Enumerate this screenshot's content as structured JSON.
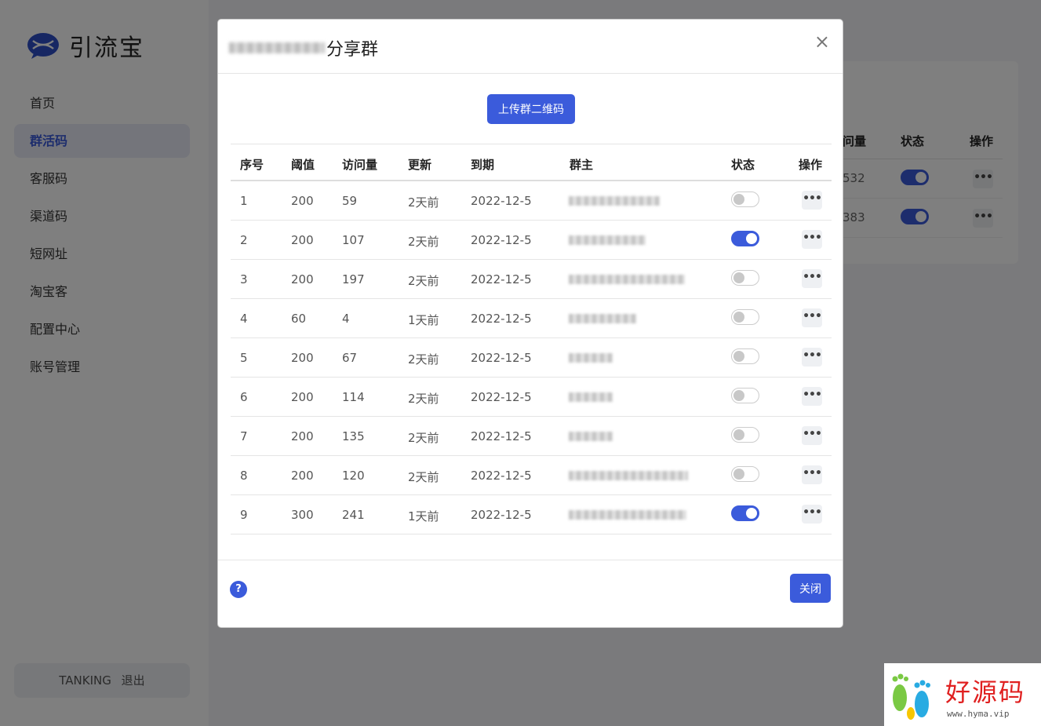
{
  "app": {
    "name": "引流宝"
  },
  "sidebar": {
    "items": [
      {
        "label": "首页",
        "active": false
      },
      {
        "label": "群活码",
        "active": true
      },
      {
        "label": "客服码",
        "active": false
      },
      {
        "label": "渠道码",
        "active": false
      },
      {
        "label": "短网址",
        "active": false
      },
      {
        "label": "淘宝客",
        "active": false
      },
      {
        "label": "配置中心",
        "active": false
      },
      {
        "label": "账号管理",
        "active": false
      }
    ],
    "user": {
      "name": "TANKING",
      "logout": "退出"
    }
  },
  "background_table": {
    "headers": [
      "问量",
      "状态",
      "操作"
    ],
    "rows": [
      {
        "visits": "532",
        "enabled": true
      },
      {
        "visits": "383",
        "enabled": true
      }
    ]
  },
  "modal": {
    "title_suffix": "分享群",
    "upload_button": "上传群二维码",
    "columns": [
      "序号",
      "阈值",
      "访问量",
      "更新",
      "到期",
      "群主",
      "状态",
      "操作"
    ],
    "rows": [
      {
        "index": "1",
        "threshold": "200",
        "visits": "59",
        "updated": "2天前",
        "expires": "2022-12-5",
        "enabled": false
      },
      {
        "index": "2",
        "threshold": "200",
        "visits": "107",
        "updated": "2天前",
        "expires": "2022-12-5",
        "enabled": true
      },
      {
        "index": "3",
        "threshold": "200",
        "visits": "197",
        "updated": "2天前",
        "expires": "2022-12-5",
        "enabled": false
      },
      {
        "index": "4",
        "threshold": "60",
        "visits": "4",
        "updated": "1天前",
        "expires": "2022-12-5",
        "enabled": false
      },
      {
        "index": "5",
        "threshold": "200",
        "visits": "67",
        "updated": "2天前",
        "expires": "2022-12-5",
        "enabled": false
      },
      {
        "index": "6",
        "threshold": "200",
        "visits": "114",
        "updated": "2天前",
        "expires": "2022-12-5",
        "enabled": false
      },
      {
        "index": "7",
        "threshold": "200",
        "visits": "135",
        "updated": "2天前",
        "expires": "2022-12-5",
        "enabled": false
      },
      {
        "index": "8",
        "threshold": "200",
        "visits": "120",
        "updated": "2天前",
        "expires": "2022-12-5",
        "enabled": false
      },
      {
        "index": "9",
        "threshold": "300",
        "visits": "241",
        "updated": "1天前",
        "expires": "2022-12-5",
        "enabled": true
      }
    ],
    "more_label": "•••",
    "help_label": "?",
    "close_button": "关闭",
    "close_icon": "×"
  },
  "watermark": {
    "text": "好源码",
    "url": "www.hyma.vip"
  },
  "colors": {
    "accent": "#3b5bdb"
  }
}
